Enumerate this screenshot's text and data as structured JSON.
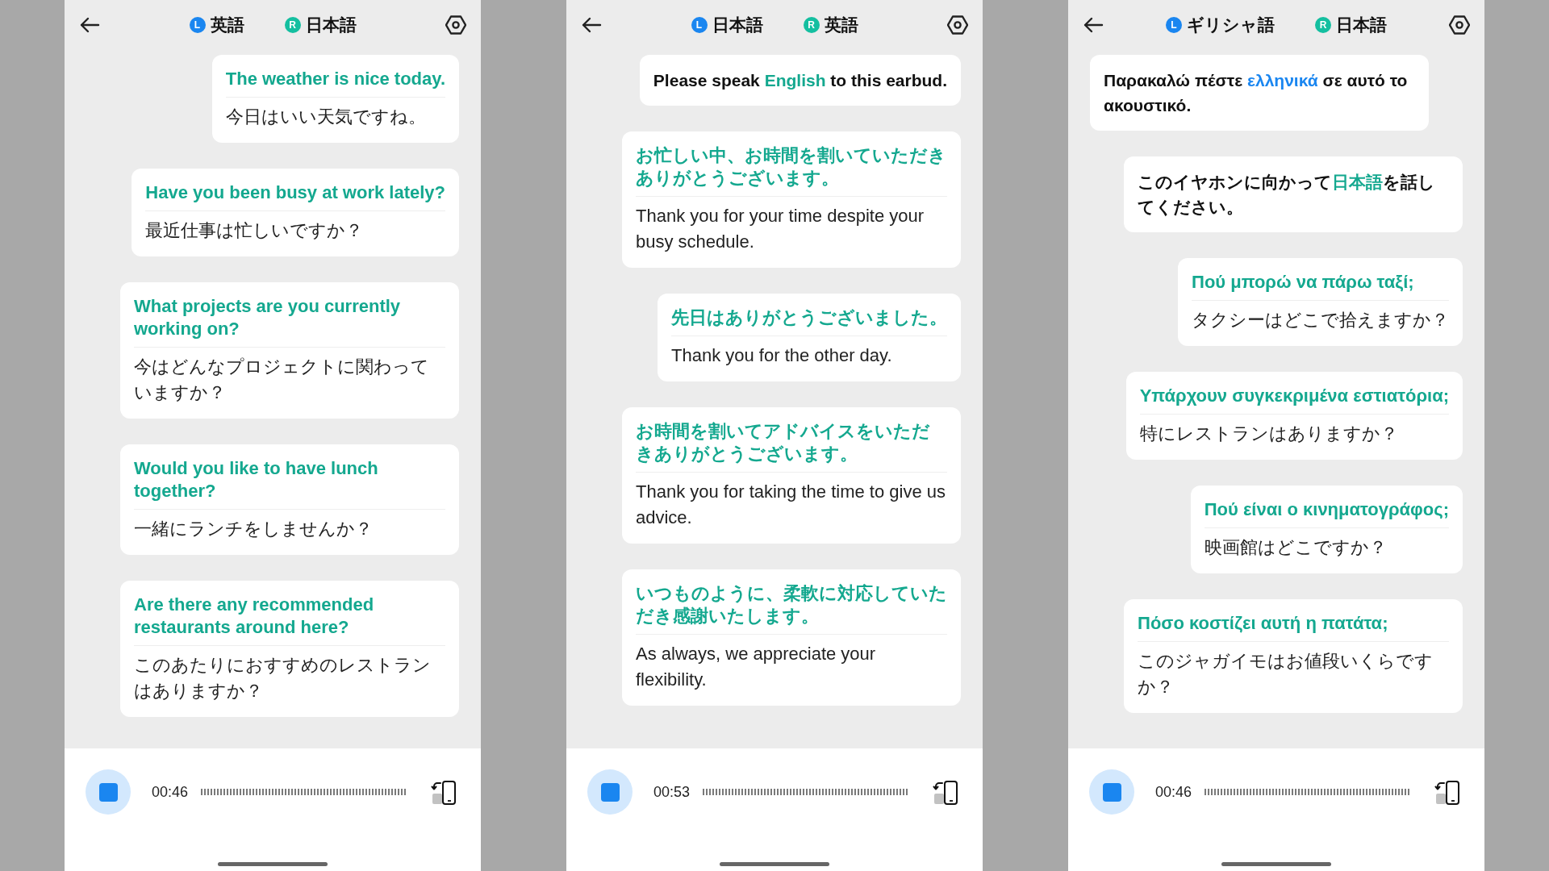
{
  "phones": [
    {
      "header": {
        "left_badge": "L",
        "left_language": "英語",
        "right_badge": "R",
        "right_language": "日本語"
      },
      "messages": [
        {
          "kind": "pair",
          "source": "The weather is nice today.",
          "translation": "今日はいい天気ですね。"
        },
        {
          "kind": "pair",
          "source": "Have you been busy at work lately?",
          "translation": "最近仕事は忙しいですか？"
        },
        {
          "kind": "pair",
          "source": "What projects are you currently working on?",
          "translation": "今はどんなプロジェクトに関わっていますか？"
        },
        {
          "kind": "pair",
          "source": "Would you like to have lunch together?",
          "translation": "一緒にランチをしませんか？"
        },
        {
          "kind": "pair",
          "source": "Are there any recommended restaurants around here?",
          "translation": "このあたりにおすすめのレストランはありますか？"
        }
      ],
      "player": {
        "time": "00:46"
      }
    },
    {
      "header": {
        "left_badge": "L",
        "left_language": "日本語",
        "right_badge": "R",
        "right_language": "英語"
      },
      "messages": [
        {
          "kind": "prompt",
          "before": "Please speak ",
          "highlight": "English",
          "after": " to this earbud.",
          "color": "#14a88f"
        },
        {
          "kind": "pair",
          "source": "お忙しい中、お時間を割いていただきありがとうございます。",
          "translation": "Thank you for your time despite your busy schedule."
        },
        {
          "kind": "pair",
          "source": "先日はありがとうございました。",
          "translation": "Thank you for the other day."
        },
        {
          "kind": "pair",
          "source": "お時間を割いてアドバイスをいただきありがとうございます。",
          "translation": "Thank you for taking the time to give us advice."
        },
        {
          "kind": "pair",
          "source": "いつものように、柔軟に対応していただき感謝いたします。",
          "translation": "As always, we appreciate your flexibility."
        }
      ],
      "player": {
        "time": "00:53"
      }
    },
    {
      "header": {
        "left_badge": "L",
        "left_language": "ギリシャ語",
        "right_badge": "R",
        "right_language": "日本語"
      },
      "messages": [
        {
          "kind": "echo",
          "before": "Παρακαλώ πέστε ",
          "highlight": "ελληνικά",
          "after": " σε αυτό το ακουστικό.",
          "color": "#1a86f0"
        },
        {
          "kind": "prompt",
          "before": "このイヤホンに向かって",
          "highlight": "日本語",
          "after": "を話してください。",
          "color": "#14a88f"
        },
        {
          "kind": "pair",
          "source": "Πού μπορώ να πάρω ταξί;",
          "translation": "タクシーはどこで拾えますか？"
        },
        {
          "kind": "pair",
          "source": "Υπάρχουν συγκεκριμένα εστιατόρια;",
          "translation": "特にレストランはありますか？"
        },
        {
          "kind": "pair",
          "source": "Πού είναι ο κινηματογράφος;",
          "translation": "映画館はどこですか？"
        },
        {
          "kind": "pair",
          "source": "Πόσο κοστίζει αυτή η πατάτα;",
          "translation": "このジャガイモはお値段いくらですか？"
        }
      ],
      "player": {
        "time": "00:46"
      }
    }
  ]
}
